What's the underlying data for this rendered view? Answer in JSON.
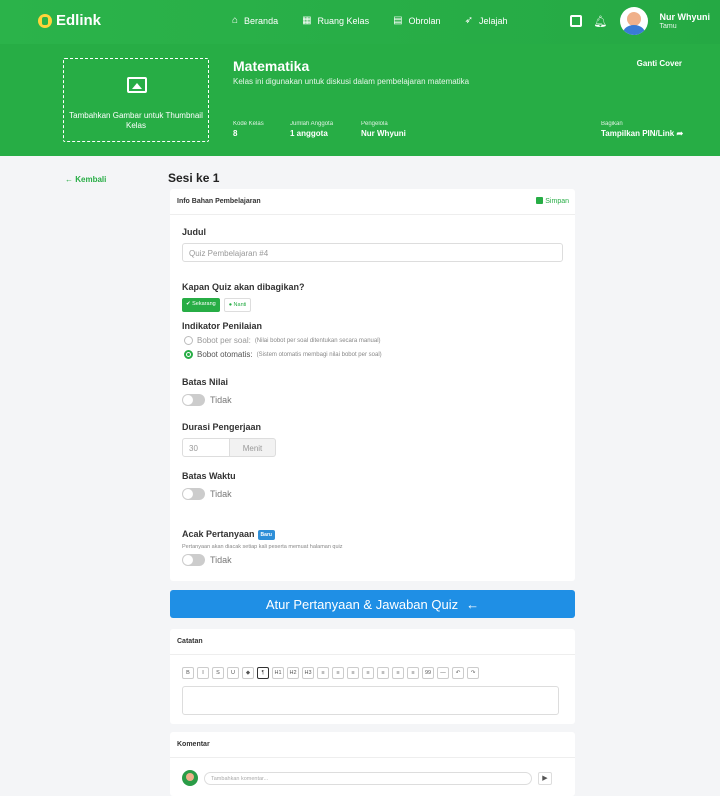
{
  "app": {
    "name": "Edlink"
  },
  "nav": {
    "items": [
      {
        "label": "Beranda",
        "icon": "home-icon"
      },
      {
        "label": "Ruang Kelas",
        "icon": "classroom-icon"
      },
      {
        "label": "Obrolan",
        "icon": "chat-icon"
      },
      {
        "label": "Jelajah",
        "icon": "rocket-icon"
      }
    ],
    "user": {
      "name": "Nur Whyuni",
      "role": "Tamu"
    }
  },
  "hero": {
    "thumbnail_text": "Tambahkan Gambar untuk Thumbnail Kelas",
    "title": "Matematika",
    "description": "Kelas ini digunakan untuk diskusi dalam pembelajaran matematika",
    "change_cover": "Ganti Cover",
    "meta": [
      {
        "label": "Kode Kelas",
        "value": "8"
      },
      {
        "label": "Jumlah Anggota",
        "value": "1 anggota"
      },
      {
        "label": "Pengelola",
        "value": "Nur Whyuni"
      }
    ],
    "share": {
      "label": "Bagikan",
      "value": "Tampilkan PIN/Link"
    }
  },
  "back_label": "Kembali",
  "session_title": "Sesi ke 1",
  "form": {
    "header": "Info Bahan Pembelajaran",
    "save_label": "Simpan",
    "judul_label": "Judul",
    "judul_value": "Quiz Pembelajaran #4",
    "share_when_label": "Kapan Quiz akan dibagikan?",
    "share_now": "Sekarang",
    "share_later": "Nanti",
    "indicator_label": "Indikator Penilaian",
    "radio1": {
      "label": "Bobot per soal:",
      "note": "(Nilai bobot per soal ditentukan secara manual)"
    },
    "radio2": {
      "label": "Bobot otomatis:",
      "note": "(Sistem otomatis membagi nilai bobot per soal)"
    },
    "batas_nilai_label": "Batas Nilai",
    "batas_nilai_value": "Tidak",
    "durasi_label": "Durasi Pengerjaan",
    "durasi_value": "30",
    "durasi_unit": "Menit",
    "batas_waktu_label": "Batas Waktu",
    "batas_waktu_value": "Tidak",
    "acak_label": "Acak Pertanyaan",
    "acak_badge": "Baru",
    "acak_note": "Pertanyaan akan diacak setiap kali peserta memuat halaman quiz",
    "acak_value": "Tidak"
  },
  "cta": {
    "label": "Atur Pertanyaan & Jawaban Quiz"
  },
  "notes": {
    "header": "Catatan",
    "toolbar": [
      "B",
      "I",
      "S",
      "U",
      "◆",
      "¶",
      "H1",
      "H2",
      "H3",
      "≡",
      "≡",
      "≡",
      "≡",
      "≡",
      "≡",
      "≡",
      "99",
      "—",
      "↶",
      "↷"
    ]
  },
  "comments": {
    "header": "Komentar",
    "placeholder": "Tambahkan komentar..."
  }
}
